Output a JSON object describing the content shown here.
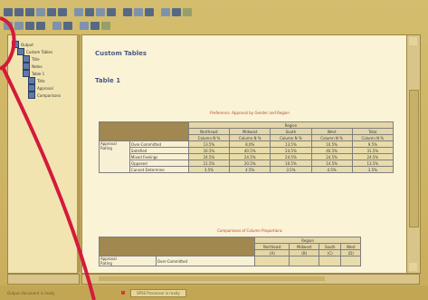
{
  "window": {
    "accent": "#c9b063",
    "highlight_color": "#d41a3c"
  },
  "toolbar": {
    "row1_icons": [
      "open-icon",
      "save-icon",
      "print-icon",
      "export-icon",
      "undo-icon",
      "redo-icon",
      "goto-data-icon",
      "goto-case-icon",
      "variables-icon",
      "find-icon",
      "insert-case-icon",
      "split-file-icon",
      "weight-icon",
      "select-cases-icon",
      "labels-icon",
      "designate-window-icon"
    ],
    "row2_icons": [
      "back-icon",
      "forward-icon",
      "expand-icon",
      "collapse-icon",
      "show-icon",
      "hide-icon",
      "promote-icon",
      "demote-icon",
      "insert-heading-icon",
      "insert-title-icon",
      "insert-text-icon"
    ]
  },
  "outline": {
    "items": [
      {
        "label": "Output"
      },
      {
        "label": "Custom Tables"
      },
      {
        "label": "Title"
      },
      {
        "label": "Notes"
      },
      {
        "label": "Table 1"
      },
      {
        "label": "Title"
      },
      {
        "label": "Approval"
      },
      {
        "label": "Comparisons"
      }
    ]
  },
  "content": {
    "heading": "Custom Tables",
    "subheading": "Table 1",
    "table1": {
      "title": "Preference: Approval by Gender and Region",
      "header_group": "Region",
      "columns": [
        [
          "Northeast",
          "Column N %"
        ],
        [
          "Midwest",
          "Column N %"
        ],
        [
          "South",
          "Column N %"
        ],
        [
          "West",
          "Column N %"
        ],
        [
          "Total",
          "Column N %"
        ]
      ],
      "row_group": [
        "Approval",
        "Rating"
      ],
      "rows": [
        {
          "label": "Over-Committed",
          "values": [
            "13.5%",
            "8.0%",
            "13.5%",
            "10.5%",
            "9.5%"
          ]
        },
        {
          "label": "Satisfied",
          "values": [
            "16.5%",
            "40.5%",
            "24.5%",
            "40.5%",
            "31.5%"
          ]
        },
        {
          "label": "Mixed Feelings",
          "values": [
            "24.5%",
            "24.5%",
            "24.5%",
            "24.5%",
            "24.5%"
          ]
        },
        {
          "label": "Opposed",
          "values": [
            "11.5%",
            "20.5%",
            "10.5%",
            "14.5%",
            "13.5%"
          ]
        },
        {
          "label": "Cannot Determine",
          "values": [
            "3.5%",
            "4.5%",
            "3.5%",
            "4.5%",
            "3.5%"
          ]
        }
      ]
    },
    "table2": {
      "title": "Comparisons of Column Proportions",
      "header_group": "Region",
      "columns": [
        [
          "Northeast",
          "(A)"
        ],
        [
          "Midwest",
          "(B)"
        ],
        [
          "South",
          "(C)"
        ],
        [
          "West",
          "(D)"
        ]
      ],
      "row_group": [
        "Approval",
        "Rating"
      ],
      "rows": [
        {
          "label": "Over-Committed",
          "values": [
            "",
            "",
            "",
            ""
          ]
        }
      ]
    }
  },
  "status": {
    "left": "Output document is ready",
    "processor": "SPSS Processor is ready"
  }
}
